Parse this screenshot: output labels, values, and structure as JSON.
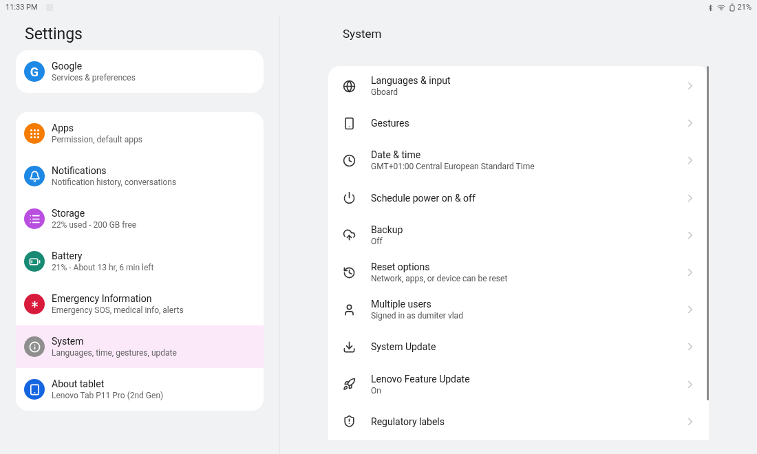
{
  "status_bar": {
    "time": "11:33 PM",
    "battery": "21%"
  },
  "sidebar": {
    "title": "Settings",
    "groups": [
      [
        {
          "letter": "G",
          "color": "#1e88e5",
          "title": "Google",
          "subtitle": "Services & preferences",
          "selected": false
        }
      ],
      [
        {
          "color": "#f57c00",
          "title": "Apps",
          "subtitle": "Permission, default apps",
          "selected": false
        },
        {
          "color": "#1e88e5",
          "title": "Notifications",
          "subtitle": "Notification history, conversations",
          "selected": false
        },
        {
          "color": "#b94fe0",
          "title": "Storage",
          "subtitle": "22% used - 200 GB free",
          "selected": false
        },
        {
          "color": "#178a74",
          "title": "Battery",
          "subtitle": "21% - About 13 hr, 6 min left",
          "selected": false
        },
        {
          "color": "#d81b3c",
          "title": "Emergency Information",
          "subtitle": "Emergency SOS, medical info, alerts",
          "selected": false
        },
        {
          "color": "#8f8f8f",
          "title": "System",
          "subtitle": "Languages, time, gestures, update",
          "selected": true
        },
        {
          "color": "#1565e0",
          "title": "About tablet",
          "subtitle": "Lenovo Tab P11 Pro (2nd Gen)",
          "selected": false
        }
      ]
    ]
  },
  "detail": {
    "title": "System",
    "items": [
      {
        "title": "Languages & input",
        "subtitle": "Gboard"
      },
      {
        "title": "Gestures"
      },
      {
        "title": "Date & time",
        "subtitle": "GMT+01:00 Central European Standard Time"
      },
      {
        "title": "Schedule power on & off"
      },
      {
        "title": "Backup",
        "subtitle": "Off"
      },
      {
        "title": "Reset options",
        "subtitle": "Network, apps, or device can be reset"
      },
      {
        "title": "Multiple users",
        "subtitle": "Signed in as dumiter vlad"
      },
      {
        "title": "System Update"
      },
      {
        "title": "Lenovo Feature Update",
        "subtitle": "On"
      },
      {
        "title": "Regulatory labels"
      }
    ]
  }
}
